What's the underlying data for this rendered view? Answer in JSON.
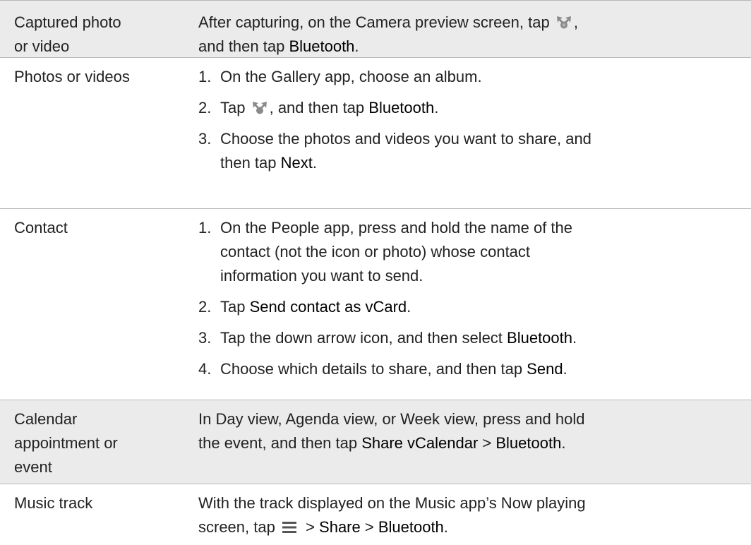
{
  "rows": [
    {
      "label": [
        "Captured photo",
        "or video"
      ],
      "text_a": "After capturing, on the Camera preview screen, tap ",
      "text_b": ",",
      "text_c": "and then tap ",
      "ui_1": "Bluetooth",
      "text_d": "."
    },
    {
      "label": "Photos or videos",
      "steps": [
        {
          "num": "1.",
          "text": "On the Gallery app, choose an album."
        },
        {
          "num": "2.",
          "pre": "Tap ",
          "mid": ", and then tap ",
          "ui": "Bluetooth",
          "post": "."
        },
        {
          "num": "3.",
          "line1": "Choose the photos and videos you want to share, and",
          "pre2": "then tap ",
          "ui": "Next",
          "post": "."
        }
      ]
    },
    {
      "label": "Contact",
      "steps": [
        {
          "num": "1.",
          "lines": [
            "On the People app, press and hold the name of the",
            "contact (not the icon or photo) whose contact",
            "information you want to send."
          ]
        },
        {
          "num": "2.",
          "pre": "Tap ",
          "ui": "Send contact as vCard",
          "post": "."
        },
        {
          "num": "3.",
          "pre": "Tap the down arrow icon, and then select ",
          "ui": "Bluetooth",
          "post": "."
        },
        {
          "num": "4.",
          "pre": "Choose which details to share, and then tap ",
          "ui": "Send",
          "post": "."
        }
      ]
    },
    {
      "label": [
        "Calendar",
        "appointment or",
        "event"
      ],
      "line1": "In Day view, Agenda view, or Week view, press and hold",
      "pre2": "the event, and then tap ",
      "ui_1": "Share vCalendar",
      "sep": " > ",
      "ui_2": "Bluetooth",
      "post": "."
    },
    {
      "label": "Music track",
      "line1": "With the track displayed on the Music app’s Now playing",
      "pre2": "screen, tap ",
      "sep1": " > ",
      "ui_1": "Share",
      "sep2": " > ",
      "ui_2": "Bluetooth",
      "post": "."
    }
  ],
  "icons": {
    "share": "share-icon",
    "menu": "menu-icon",
    "share_color": "#8a8a8a",
    "menu_color": "#555555"
  },
  "colors": {
    "shaded_row": "#ebebeb",
    "divider": "#b9b9b9",
    "text": "#222222"
  }
}
